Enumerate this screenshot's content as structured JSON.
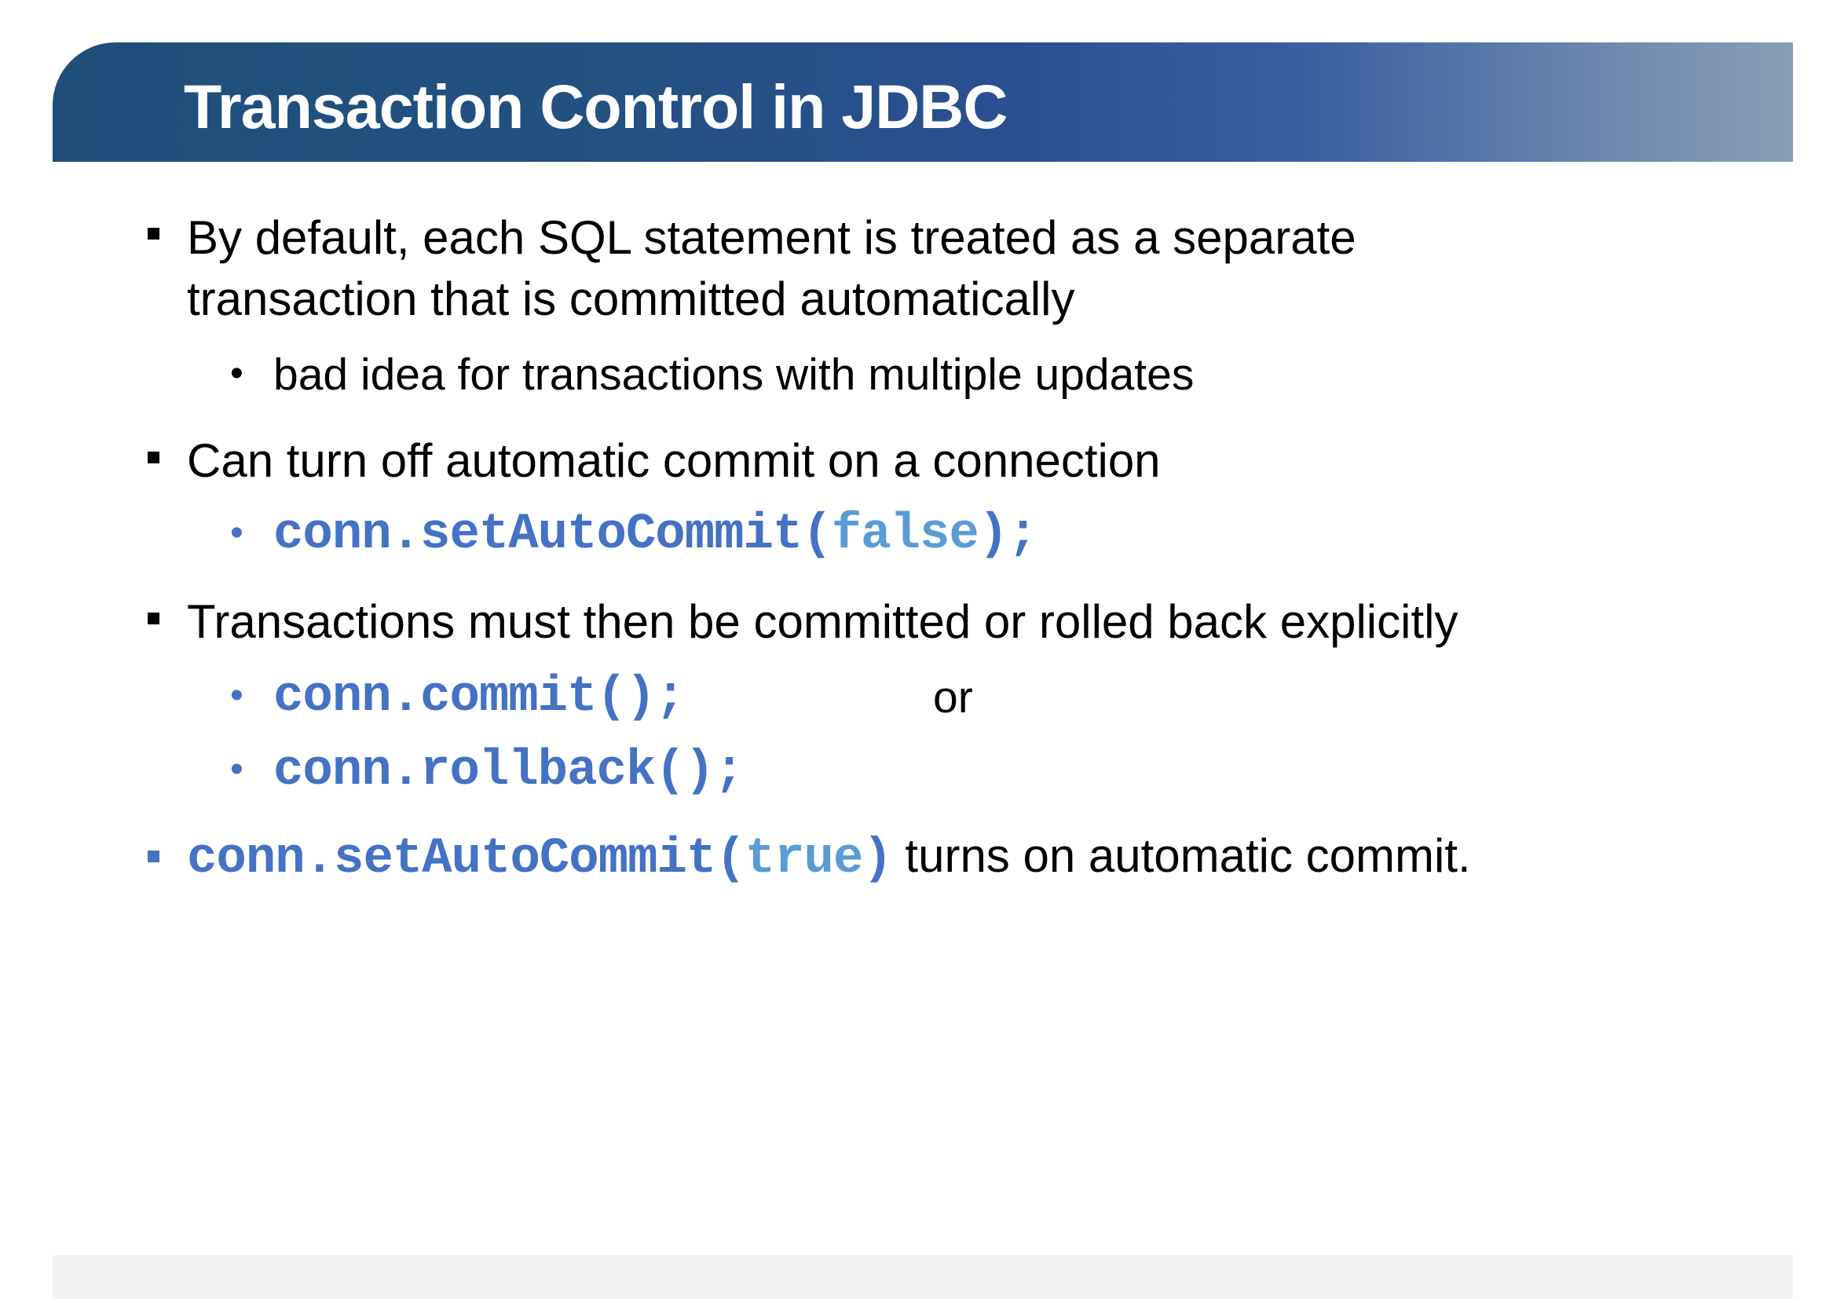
{
  "slide": {
    "title": "Transaction Control in JDBC",
    "bullets": [
      {
        "text_line1": "By default, each SQL statement is treated as a separate",
        "text_line2": "transaction that is committed automatically",
        "sub": "bad idea for transactions with multiple updates"
      },
      {
        "text": "Can turn off automatic commit on a connection",
        "sub_code_prefix": "conn.setAutoCommit(",
        "sub_code_literal": "false",
        "sub_code_suffix": ");"
      },
      {
        "text": "Transactions must then be committed or rolled back explicitly",
        "sub1_code": "conn.commit();",
        "sub1_or": "or",
        "sub2_code": "conn.rollback();"
      },
      {
        "code_prefix": "conn.setAutoCommit(",
        "code_literal": "true",
        "code_suffix": ")",
        "text": " turns on automatic commit."
      }
    ]
  },
  "colors": {
    "title_bar_start": "#1f4e7b",
    "title_bar_end": "#8a9db5",
    "code": "#4472c4",
    "code_literal": "#5b9bd5",
    "footer": "#f2f2f2"
  }
}
